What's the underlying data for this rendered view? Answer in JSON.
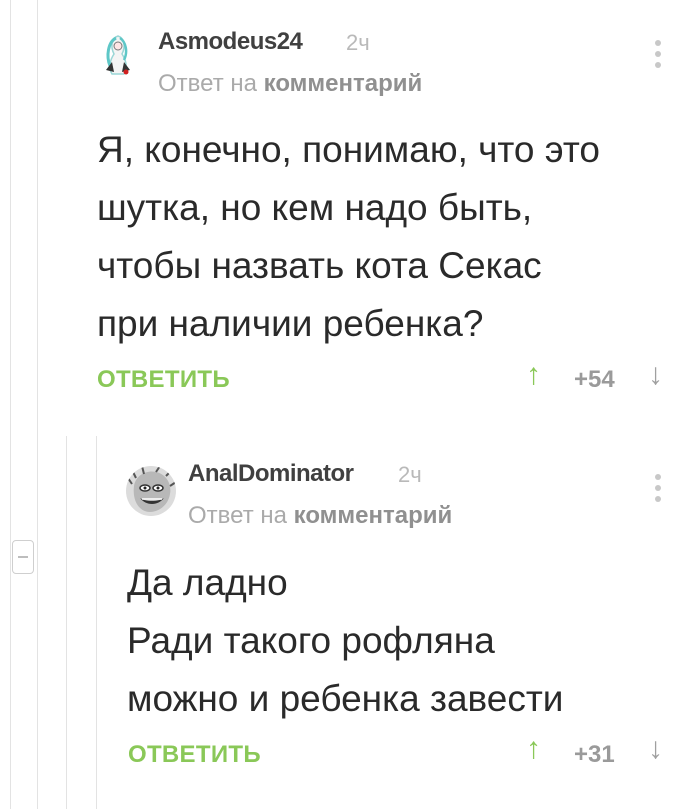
{
  "comments": [
    {
      "author": "Asmodeus24",
      "time": "2ч",
      "reply_prefix": "Ответ на",
      "reply_target": "комментарий",
      "lines": [
        "Я, конечно, понимаю, что это",
        "шутка, но кем надо быть,",
        "чтобы назвать кота Секас",
        "при наличии ребенка?"
      ],
      "reply_label": "ОТВЕТИТЬ",
      "rating": "+54",
      "up_icon": "arrow-up-icon",
      "down_icon": "arrow-down-icon"
    },
    {
      "author": "AnalDominator",
      "time": "2ч",
      "reply_prefix": "Ответ на",
      "reply_target": "комментарий",
      "lines": [
        "Да ладно",
        "Ради такого рофляна",
        "можно и ребенка завести"
      ],
      "reply_label": "ОТВЕТИТЬ",
      "rating": "+31",
      "up_icon": "arrow-up-icon",
      "down_icon": "arrow-down-icon"
    }
  ],
  "colors": {
    "accent_green": "#8ac858",
    "thread_line": "#e3e3e3",
    "author": "#404040",
    "muted": "#aaaaaa"
  }
}
